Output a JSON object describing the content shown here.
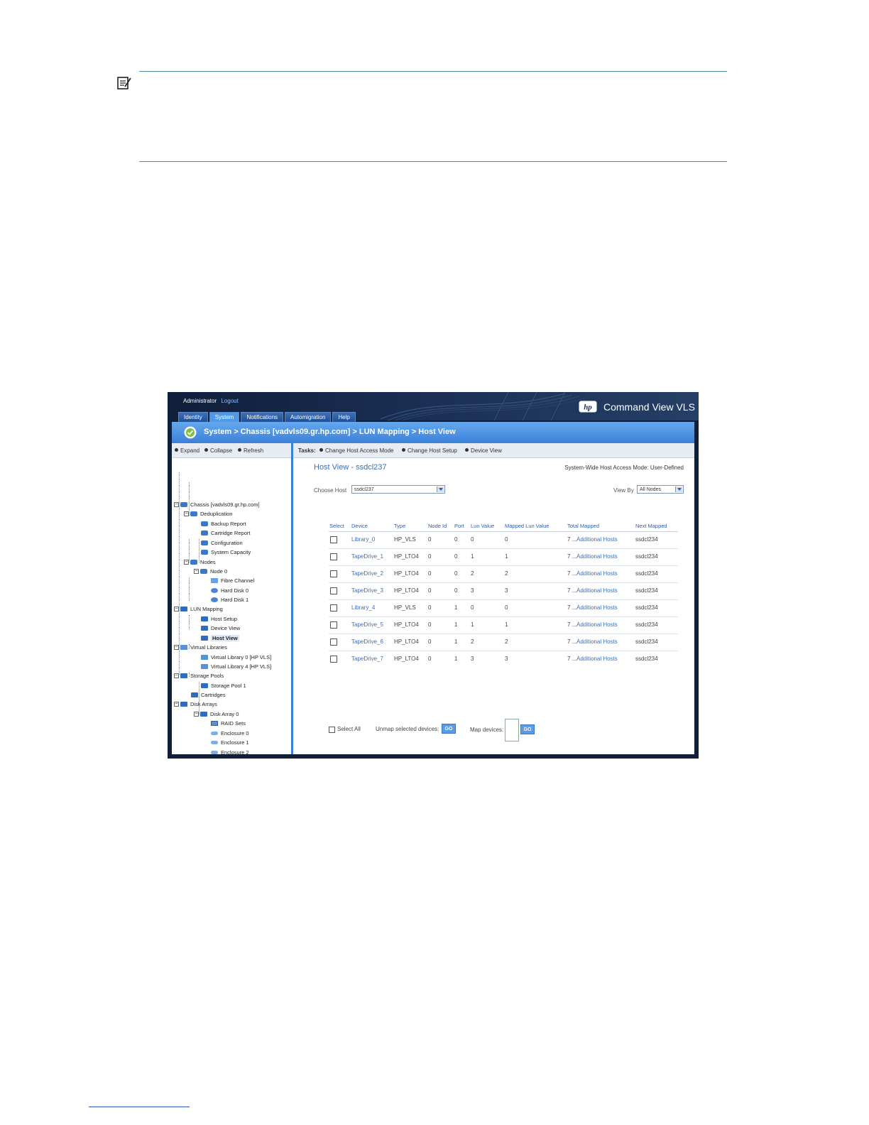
{
  "app": {
    "user": "Administrator",
    "logout": "Logout",
    "brand": "Command View VLS",
    "tabs": [
      "Identity",
      "System",
      "Notifications",
      "Automigration",
      "Help"
    ],
    "active_tab": "System",
    "breadcrumb": "System  >  Chassis  [vadvls09.gr.hp.com]  >  LUN  Mapping  >  Host  View"
  },
  "toolbar": {
    "expand": "Expand",
    "collapse": "Collapse",
    "refresh": "Refresh",
    "tasks_label": "Tasks:",
    "task_change_mode": "Change Host Access Mode",
    "task_change_setup": "Change Host Setup",
    "task_device_view": "Device View"
  },
  "tree": {
    "chassis": "Chassis [vadvls09.gr.hp.com]",
    "deduplication": "Deduplication",
    "backup_report": "Backup Report",
    "cartridge_report": "Cartridge Report",
    "configuration": "Configuration",
    "system_capacity": "System Capacity",
    "nodes": "Nodes",
    "node0": "Node 0",
    "fibre_channel": "Fibre Channel",
    "hard_disk0": "Hard Disk 0",
    "hard_disk1": "Hard Disk 1",
    "lun_mapping": "LUN Mapping",
    "host_setup": "Host Setup",
    "device_view": "Device View",
    "host_view": "Host View",
    "virtual_libraries": "Virtual Libraries",
    "vlib0": "Virtual Library 0 [HP VLS]",
    "vlib4": "Virtual Library 4 [HP VLS]",
    "storage_pools": "Storage Pools",
    "storage_pool1": "Storage Pool 1",
    "cartridges": "Cartridges",
    "disk_arrays": "Disk Arrays",
    "disk_array0": "Disk Array 0",
    "raid_sets": "RAID Sets",
    "enclosure0": "Enclosure 0",
    "enclosure1": "Enclosure 1",
    "enclosure2": "Enclosure 2"
  },
  "main": {
    "title": "Host View - ssdcl237",
    "access_mode": "System-Wide Host Access Mode: User-Defined",
    "choose_host_label": "Choose Host",
    "choose_host_value": "ssdcl237",
    "view_by_label": "View By",
    "view_by_value": "All Nodes",
    "columns": [
      "Select",
      "Device",
      "Type",
      "Node Id",
      "Port",
      "Lun Value",
      "Mapped Lun Value",
      "Total Mapped",
      "Next Mapped"
    ],
    "rows": [
      {
        "device": "Library_0",
        "type": "HP_VLS",
        "node": "0",
        "port": "0",
        "lun": "0",
        "mapped": "0",
        "total": "7 ...",
        "hosts": "Additional Hosts",
        "next": "ssdcl234"
      },
      {
        "device": "TapeDrive_1",
        "type": "HP_LTO4",
        "node": "0",
        "port": "0",
        "lun": "1",
        "mapped": "1",
        "total": "7 ...",
        "hosts": "Additional Hosts",
        "next": "ssdcl234"
      },
      {
        "device": "TapeDrive_2",
        "type": "HP_LTO4",
        "node": "0",
        "port": "0",
        "lun": "2",
        "mapped": "2",
        "total": "7 ...",
        "hosts": "Additional Hosts",
        "next": "ssdcl234"
      },
      {
        "device": "TapeDrive_3",
        "type": "HP_LTO4",
        "node": "0",
        "port": "0",
        "lun": "3",
        "mapped": "3",
        "total": "7 ...",
        "hosts": "Additional Hosts",
        "next": "ssdcl234"
      },
      {
        "device": "Library_4",
        "type": "HP_VLS",
        "node": "0",
        "port": "1",
        "lun": "0",
        "mapped": "0",
        "total": "7 ...",
        "hosts": "Additional Hosts",
        "next": "ssdcl234"
      },
      {
        "device": "TapeDrive_5",
        "type": "HP_LTO4",
        "node": "0",
        "port": "1",
        "lun": "1",
        "mapped": "1",
        "total": "7 ...",
        "hosts": "Additional Hosts",
        "next": "ssdcl234"
      },
      {
        "device": "TapeDrive_6",
        "type": "HP_LTO4",
        "node": "0",
        "port": "1",
        "lun": "2",
        "mapped": "2",
        "total": "7 ...",
        "hosts": "Additional Hosts",
        "next": "ssdcl234"
      },
      {
        "device": "TapeDrive_7",
        "type": "HP_LTO4",
        "node": "0",
        "port": "1",
        "lun": "3",
        "mapped": "3",
        "total": "7 ...",
        "hosts": "Additional Hosts",
        "next": "ssdcl234"
      }
    ],
    "select_all": "Select All",
    "unmap_label": "Unmap selected devices:",
    "go": "GO",
    "map_label": "Map devices:"
  }
}
